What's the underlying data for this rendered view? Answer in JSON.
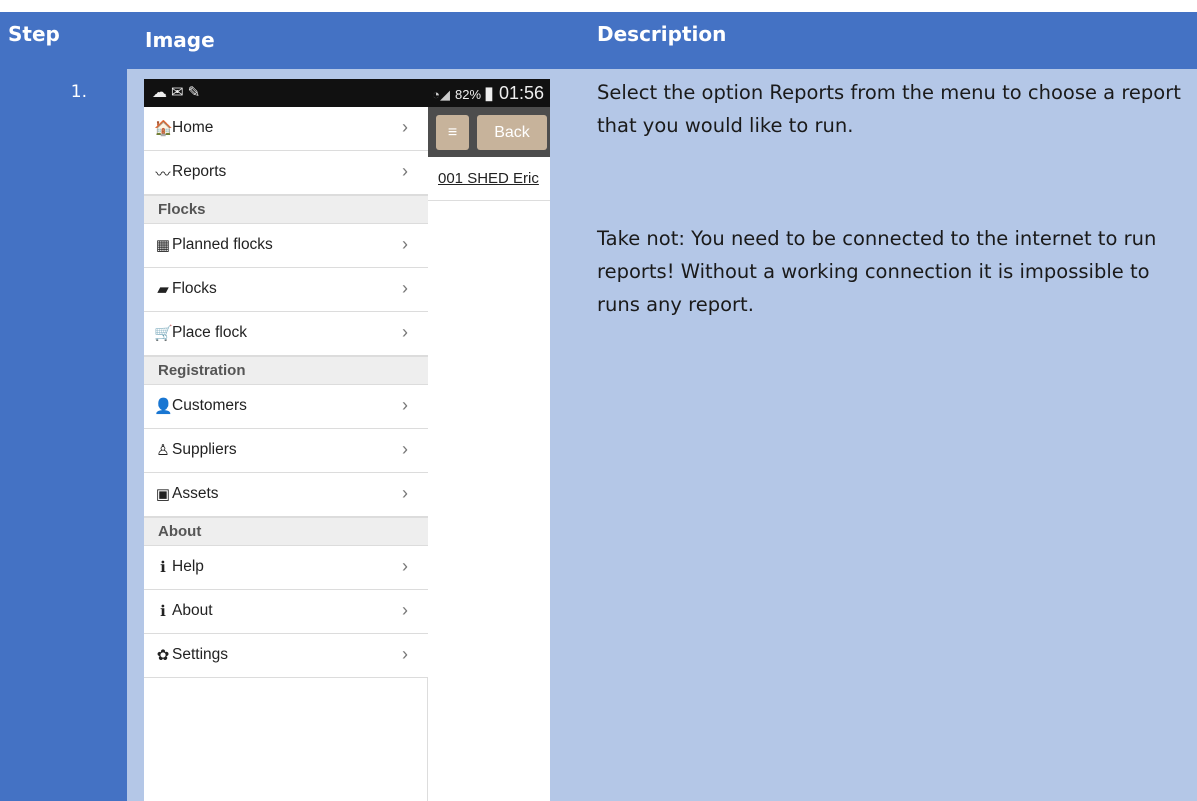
{
  "table": {
    "headers": {
      "step": "Step",
      "image": "Image",
      "description": "Description"
    },
    "row": {
      "step": "1.",
      "description": [
        "Select the option Reports from the menu to choose a report that you would like to run.",
        "Take not: You need to be connected to the internet to run reports! Without a working connection it is impossible to runs any report."
      ]
    }
  },
  "phone": {
    "status": {
      "battery": "82%",
      "time": "01:56"
    },
    "appbar": {
      "menu_icon": "≡",
      "back_label": "Back"
    },
    "content_link": "001 SHED Eric",
    "menu": [
      {
        "type": "item",
        "icon": "home-icon",
        "glyph": "🏠",
        "label": "Home"
      },
      {
        "type": "item",
        "icon": "chart-icon",
        "glyph": "〰",
        "label": "Reports"
      },
      {
        "type": "section",
        "label": "Flocks"
      },
      {
        "type": "item",
        "icon": "calendar-icon",
        "glyph": "▦",
        "label": "Planned flocks"
      },
      {
        "type": "item",
        "icon": "book-icon",
        "glyph": "▰",
        "label": "Flocks"
      },
      {
        "type": "item",
        "icon": "cart-icon",
        "glyph": "🛒",
        "label": "Place flock"
      },
      {
        "type": "section",
        "label": "Registration"
      },
      {
        "type": "item",
        "icon": "user-icon",
        "glyph": "👤",
        "label": "Customers"
      },
      {
        "type": "item",
        "icon": "user-outline-icon",
        "glyph": "♙",
        "label": "Suppliers"
      },
      {
        "type": "item",
        "icon": "briefcase-icon",
        "glyph": "▣",
        "label": "Assets"
      },
      {
        "type": "section",
        "label": "About"
      },
      {
        "type": "item",
        "icon": "info-icon",
        "glyph": "ℹ",
        "label": "Help"
      },
      {
        "type": "item",
        "icon": "info-icon",
        "glyph": "ℹ",
        "label": "About"
      },
      {
        "type": "item",
        "icon": "gear-icon",
        "glyph": "✿",
        "label": "Settings"
      }
    ],
    "chevron": "›"
  }
}
